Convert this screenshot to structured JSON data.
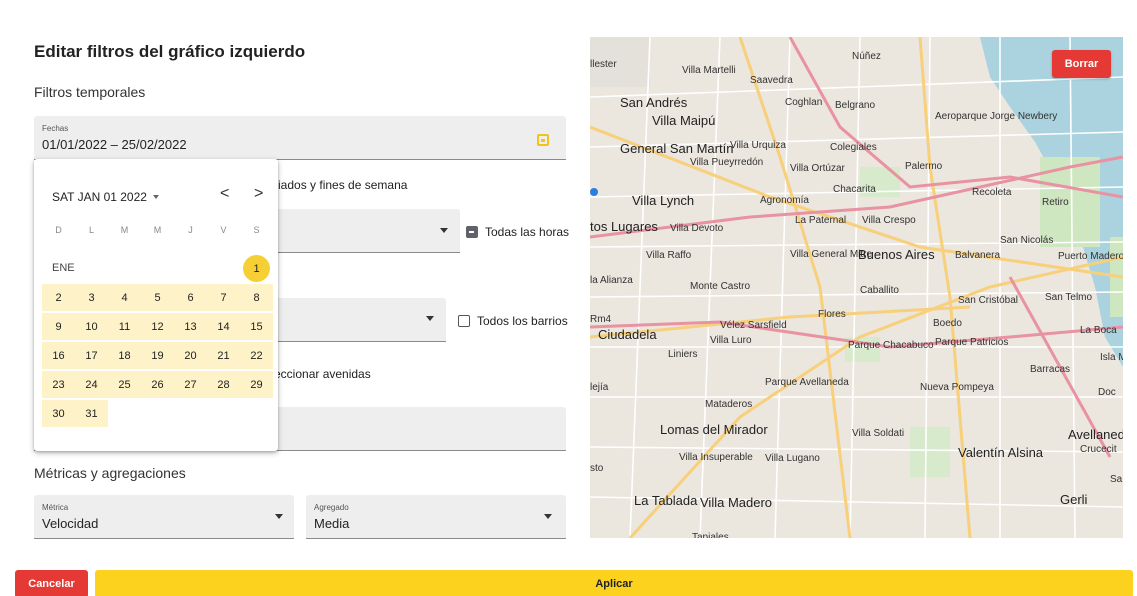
{
  "panel": {
    "title": "Editar filtros del gráfico izquierdo",
    "temporal_label": "Filtros temporales",
    "metrics_label": "Métricas y agregaciones"
  },
  "date_field": {
    "label": "Fechas",
    "value": "01/01/2022 – 25/02/2022"
  },
  "holidays_partial_text": "iados y fines de semana",
  "hours": {
    "checkbox_label": "Todas las horas"
  },
  "barrios": {
    "checkbox_label": "Todos los barrios"
  },
  "avenues_partial_text": "eccionar avenidas",
  "metric_field": {
    "label": "Métrica",
    "value": "Velocidad"
  },
  "aggregate_field": {
    "label": "Agregado",
    "value": "Media"
  },
  "datepicker": {
    "header": "SAT JAN 01 2022",
    "prev": "<",
    "next": ">",
    "weekdays": [
      "D",
      "L",
      "M",
      "M",
      "J",
      "V",
      "S"
    ],
    "month_label": "ENE",
    "days": [
      "1",
      "2",
      "3",
      "4",
      "5",
      "6",
      "7",
      "8",
      "9",
      "10",
      "11",
      "12",
      "13",
      "14",
      "15",
      "16",
      "17",
      "18",
      "19",
      "20",
      "21",
      "22",
      "23",
      "24",
      "25",
      "26",
      "27",
      "28",
      "29",
      "30",
      "31"
    ]
  },
  "map": {
    "delete_button": "Borrar",
    "labels": [
      "llester",
      "Villa Martelli",
      "Núñez",
      "Saavedra",
      "San Andrés",
      "Coghlan",
      "Belgrano",
      "Villa Maipú",
      "Aeroparque Jorge Newbery",
      "General San Martín",
      "Villa Urquiza",
      "Colegiales",
      "Villa Pueyrredón",
      "Villa Ortúzar",
      "Palermo",
      "Villa Lynch",
      "Agronomía",
      "Chacarita",
      "Recoleta",
      "Retiro",
      "tos Lugares",
      "Villa Devoto",
      "La Paternal",
      "Villa Crespo",
      "San Nicolás",
      "Villa Raffo",
      "Villa General Mitre",
      "Buenos Aires",
      "Balvanera",
      "Puerto Madero",
      "la Alianza",
      "Monte Castro",
      "Caballito",
      "San Cristóbal",
      "San Telmo",
      "Ciudadela",
      "Vélez Sarsfield",
      "Flores",
      "Boedo",
      "La Boca",
      "Villa Luro",
      "Parque Chacabuco",
      "Parque Patricios",
      "Isla Ma",
      "Liniers",
      "Barracas",
      "lejía",
      "Parque Avellaneda",
      "Nueva Pompeya",
      "Doc",
      "Mataderos",
      "Lomas del Mirador",
      "Villa Soldati",
      "Avellaneda",
      "Valentín Alsina",
      "Villa Insuperable",
      "Villa Lugano",
      "Crucecit",
      "sto",
      "Sa",
      "La Tablada",
      "Villa Madero",
      "Gerli",
      "Tapiales",
      "Rm4"
    ]
  },
  "footer": {
    "cancel": "Cancelar",
    "apply": "Aplicar"
  },
  "colors": {
    "danger": "#e53935",
    "accent": "#fcd21f",
    "range_fill": "#fdf2c8",
    "selected_day": "#f5cf34"
  }
}
